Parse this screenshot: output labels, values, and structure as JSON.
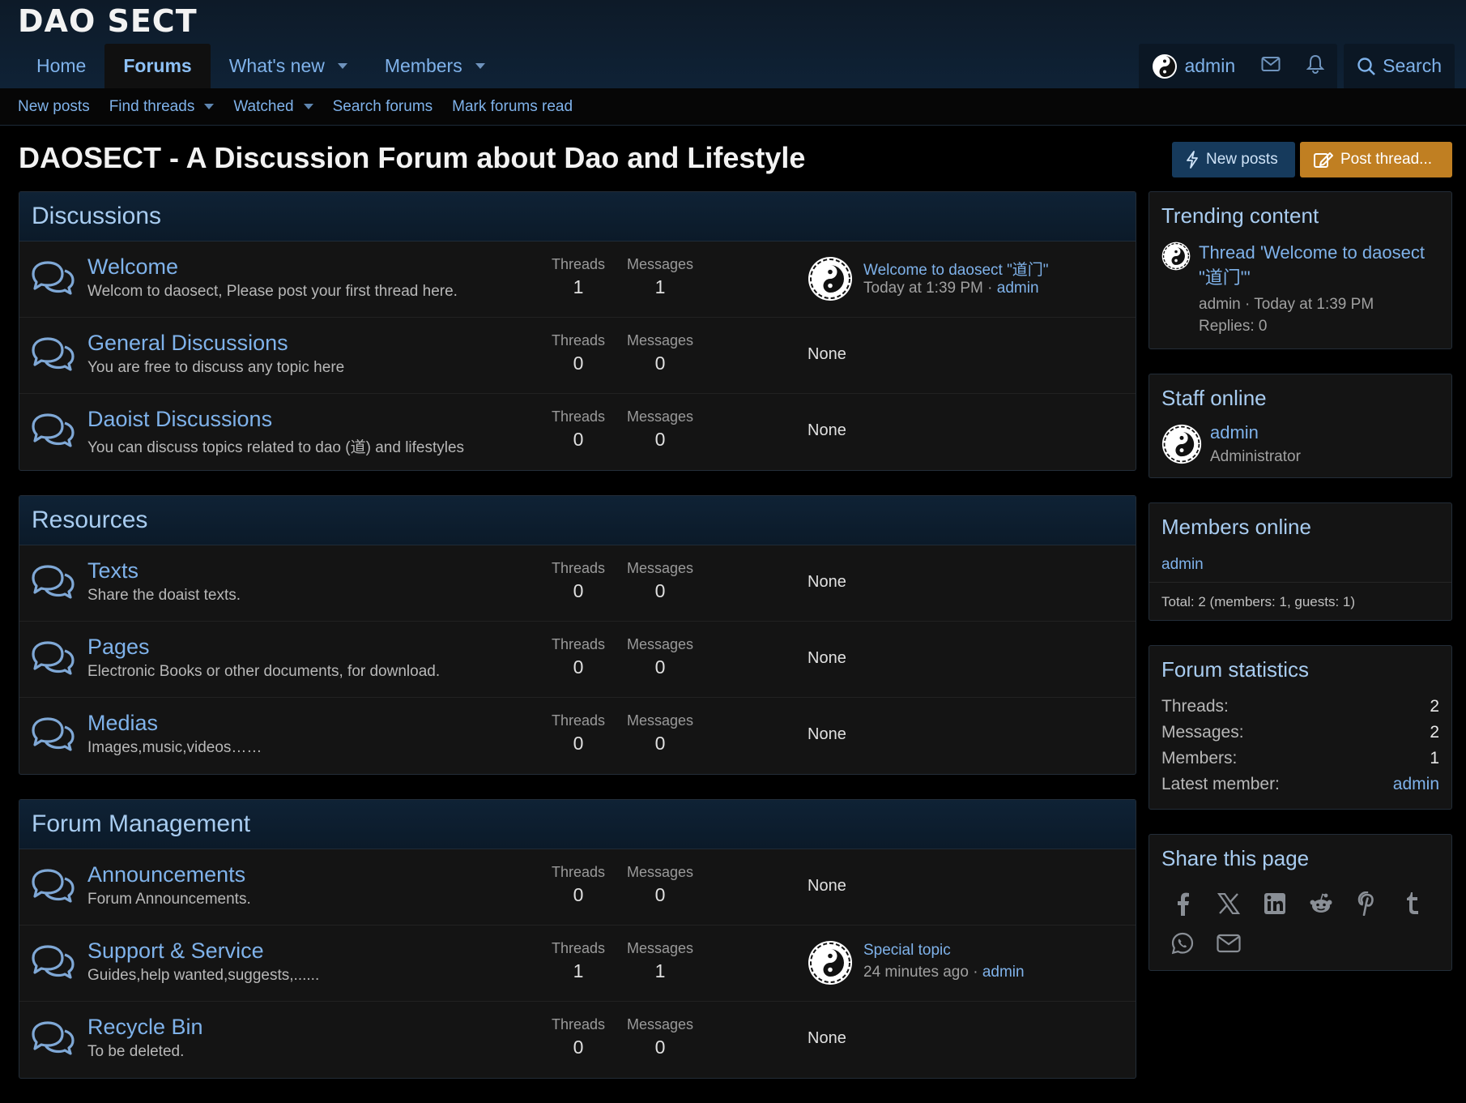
{
  "site": {
    "logo": "DAO SECT"
  },
  "nav": {
    "tabs": [
      {
        "label": "Home"
      },
      {
        "label": "Forums"
      },
      {
        "label": "What's new"
      },
      {
        "label": "Members"
      }
    ],
    "user": "admin",
    "search": "Search"
  },
  "subnav": {
    "items": [
      {
        "label": "New posts"
      },
      {
        "label": "Find threads"
      },
      {
        "label": "Watched"
      },
      {
        "label": "Search forums"
      },
      {
        "label": "Mark forums read"
      }
    ]
  },
  "page": {
    "title": "DAOSECT - A Discussion Forum about Dao and Lifestyle",
    "new_posts_btn": "New posts",
    "post_thread_btn": "Post thread..."
  },
  "labels": {
    "threads": "Threads",
    "messages": "Messages",
    "none": "None"
  },
  "categories": [
    {
      "title": "Discussions",
      "nodes": [
        {
          "title": "Welcome",
          "desc": "Welcom to daosect, Please post your first thread here.",
          "threads": "1",
          "messages": "1",
          "last_title": "Welcome to daosect \"道门\"",
          "last_time": "Today at 1:39 PM",
          "last_user": "admin"
        },
        {
          "title": "General Discussions",
          "desc": "You are free to discuss any topic here",
          "threads": "0",
          "messages": "0"
        },
        {
          "title": "Daoist Discussions",
          "desc": "You can discuss topics related to dao (道) and lifestyles",
          "threads": "0",
          "messages": "0"
        }
      ]
    },
    {
      "title": "Resources",
      "nodes": [
        {
          "title": "Texts",
          "desc": "Share the doaist texts.",
          "threads": "0",
          "messages": "0"
        },
        {
          "title": "Pages",
          "desc": "Electronic Books or other documents, for download.",
          "threads": "0",
          "messages": "0"
        },
        {
          "title": "Medias",
          "desc": "Images,music,videos……",
          "threads": "0",
          "messages": "0"
        }
      ]
    },
    {
      "title": "Forum Management",
      "nodes": [
        {
          "title": "Announcements",
          "desc": "Forum Announcements.",
          "threads": "0",
          "messages": "0"
        },
        {
          "title": "Support & Service",
          "desc": "Guides,help wanted,suggests,......",
          "threads": "1",
          "messages": "1",
          "last_title": "Special topic",
          "last_time": "24 minutes ago",
          "last_user": "admin"
        },
        {
          "title": "Recycle Bin",
          "desc": "To be deleted.",
          "threads": "0",
          "messages": "0"
        }
      ]
    }
  ],
  "sidebar": {
    "trending": {
      "title": "Trending content",
      "item_title": "Thread 'Welcome to daosect \"道门\"'",
      "item_meta": "admin · Today at 1:39 PM",
      "replies": "Replies: 0"
    },
    "staff": {
      "title": "Staff online",
      "name": "admin",
      "role": "Administrator"
    },
    "members_online": {
      "title": "Members online",
      "user": "admin",
      "total": "Total: 2 (members: 1, guests: 1)"
    },
    "stats": {
      "title": "Forum statistics",
      "rows": [
        {
          "label": "Threads:",
          "value": "2"
        },
        {
          "label": "Messages:",
          "value": "2"
        },
        {
          "label": "Members:",
          "value": "1"
        },
        {
          "label": "Latest member:",
          "value": "admin"
        }
      ]
    },
    "share": {
      "title": "Share this page",
      "icons": [
        "facebook-icon",
        "x-icon",
        "linkedin-icon",
        "reddit-icon",
        "pinterest-icon",
        "tumblr-icon",
        "whatsapp-icon",
        "email-icon"
      ]
    }
  },
  "colors": {
    "link": "#7fb2ea",
    "accent_orange": "#c07f22",
    "accent_blue": "#163a5c",
    "header_bg": "#0f2236"
  }
}
